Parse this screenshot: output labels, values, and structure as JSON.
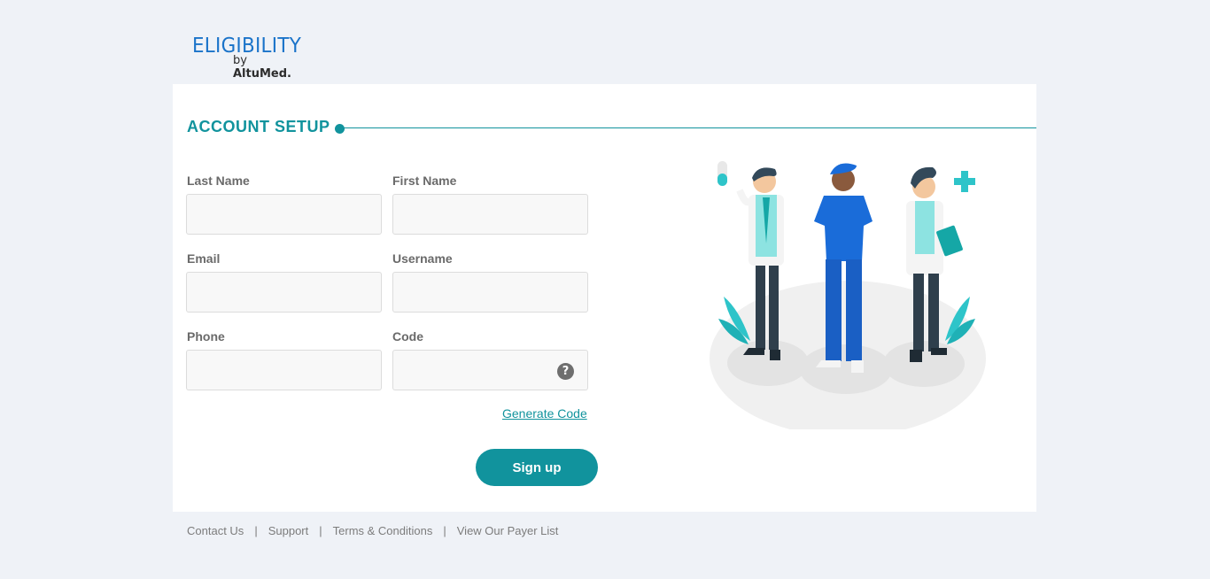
{
  "brand": {
    "name": "ELIGIBILITY",
    "by": "by ",
    "company": "AltuMed",
    "dot": "."
  },
  "form": {
    "title": "ACCOUNT SETUP",
    "fields": [
      {
        "label": "Last Name",
        "value": ""
      },
      {
        "label": "First Name",
        "value": ""
      },
      {
        "label": "Email",
        "value": ""
      },
      {
        "label": "Username",
        "value": ""
      },
      {
        "label": "Phone",
        "value": ""
      },
      {
        "label": "Code",
        "value": ""
      }
    ],
    "help_glyph": "?",
    "generate_link": "Generate Code",
    "submit_label": "Sign up"
  },
  "footer": {
    "links": [
      "Contact Us",
      "Support",
      "Terms & Conditions",
      "View Our Payer List"
    ],
    "separator": "|"
  },
  "colors": {
    "accent": "#11939d",
    "brand_blue": "#1a73c9",
    "background": "#eff2f7"
  },
  "icons": [
    "question-icon",
    "medical-staff-illustration"
  ]
}
